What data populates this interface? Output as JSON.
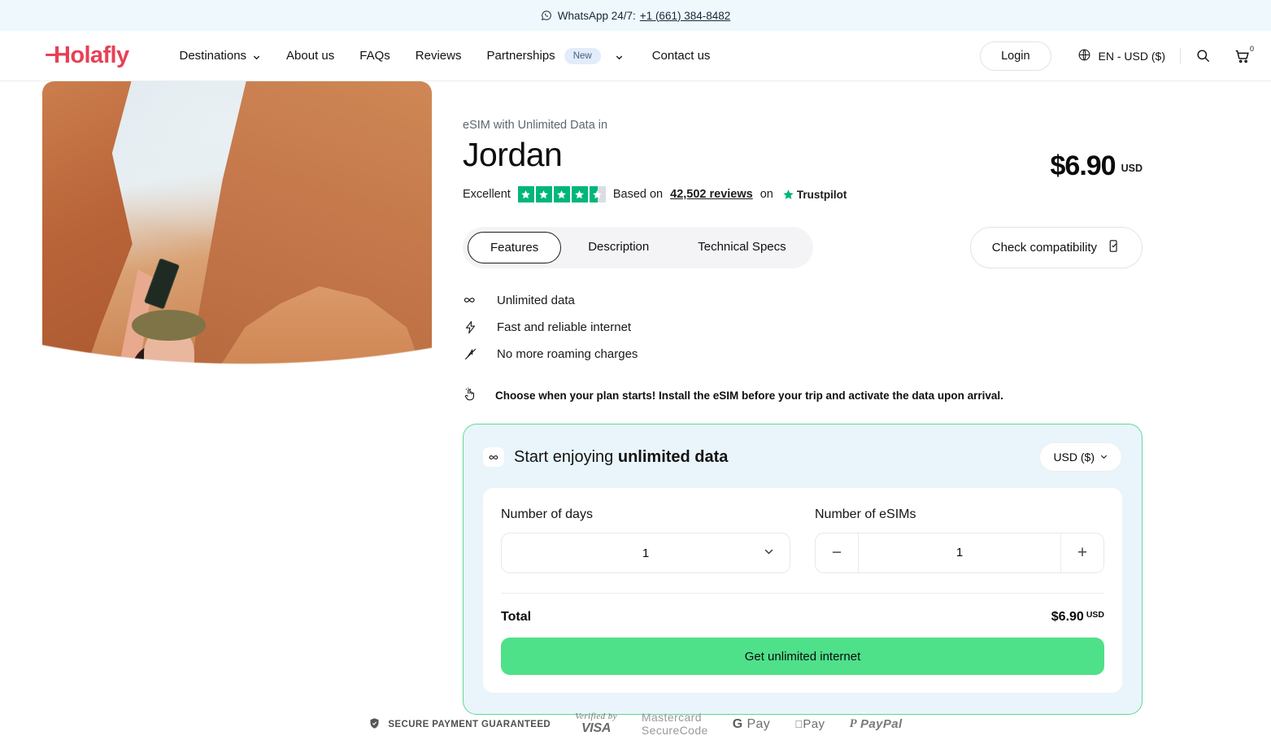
{
  "topbar": {
    "icon": "whatsapp-icon",
    "text": "WhatsApp 24/7:",
    "phone": "+1 (661) 384-8482"
  },
  "header": {
    "logo": "Holafly",
    "nav": [
      {
        "label": "Destinations",
        "has_chevron": true
      },
      {
        "label": "About us",
        "has_chevron": false
      },
      {
        "label": "FAQs",
        "has_chevron": false
      },
      {
        "label": "Reviews",
        "has_chevron": false
      },
      {
        "label": "Partnerships",
        "badge": "New",
        "has_chevron": true
      },
      {
        "label": "Contact us",
        "has_chevron": false
      }
    ],
    "login_label": "Login",
    "language": "EN - USD ($)",
    "search_icon": "search-icon",
    "cart_icon": "cart-icon",
    "cart_count": "0"
  },
  "product": {
    "eyebrow": "eSIM with Unlimited Data in",
    "title": "Jordan",
    "price": "$6.90",
    "price_currency": "USD"
  },
  "rating": {
    "word": "Excellent",
    "stars": 4.5,
    "based_on": "Based on",
    "reviews": "42,502 reviews",
    "on": "on",
    "provider": "Trustpilot",
    "star_color": "#00b67a"
  },
  "tabs": {
    "items": [
      "Features",
      "Description",
      "Technical Specs"
    ],
    "active": "Features"
  },
  "compatibility": {
    "label": "Check compatibility",
    "icon": "phone-check-icon"
  },
  "features": [
    {
      "icon": "infinity-icon",
      "label": "Unlimited data"
    },
    {
      "icon": "lightning-bolt-icon",
      "label": "Fast and reliable internet"
    },
    {
      "icon": "no-roaming-icon",
      "label": "No more roaming charges"
    }
  ],
  "note": {
    "icon": "tap-hand-icon",
    "text": "Choose when your plan starts! Install the eSIM before your trip and activate the data upon arrival."
  },
  "panel": {
    "icon": "infinity-icon",
    "title_prefix": "Start enjoying ",
    "title_bold": "unlimited data",
    "currency_value": "USD ($)",
    "border_color": "#62d898",
    "background_color": "#e9f5fb",
    "days": {
      "label": "Number of days",
      "value": "1"
    },
    "esims": {
      "label": "Number of eSIMs",
      "value": "1",
      "minus": "−",
      "plus": "+"
    },
    "total": {
      "label": "Total",
      "value": "$6.90",
      "currency": "USD"
    },
    "cta": {
      "label": "Get unlimited internet",
      "color": "#4fe08a"
    }
  },
  "payments": {
    "secure_text": "SECURE PAYMENT GUARANTEED",
    "methods": [
      {
        "name": "verified-by-visa",
        "line1": "Verified by",
        "line2": "VISA"
      },
      {
        "name": "mastercard-securecode",
        "line1": "Mastercard",
        "line2": "SecureCode"
      },
      {
        "name": "google-pay",
        "line1": "G",
        "line2": "Pay"
      },
      {
        "name": "apple-pay",
        "line1": "",
        "line2": "Pay"
      },
      {
        "name": "paypal",
        "line1": "P",
        "line2": "PayPal"
      }
    ]
  }
}
